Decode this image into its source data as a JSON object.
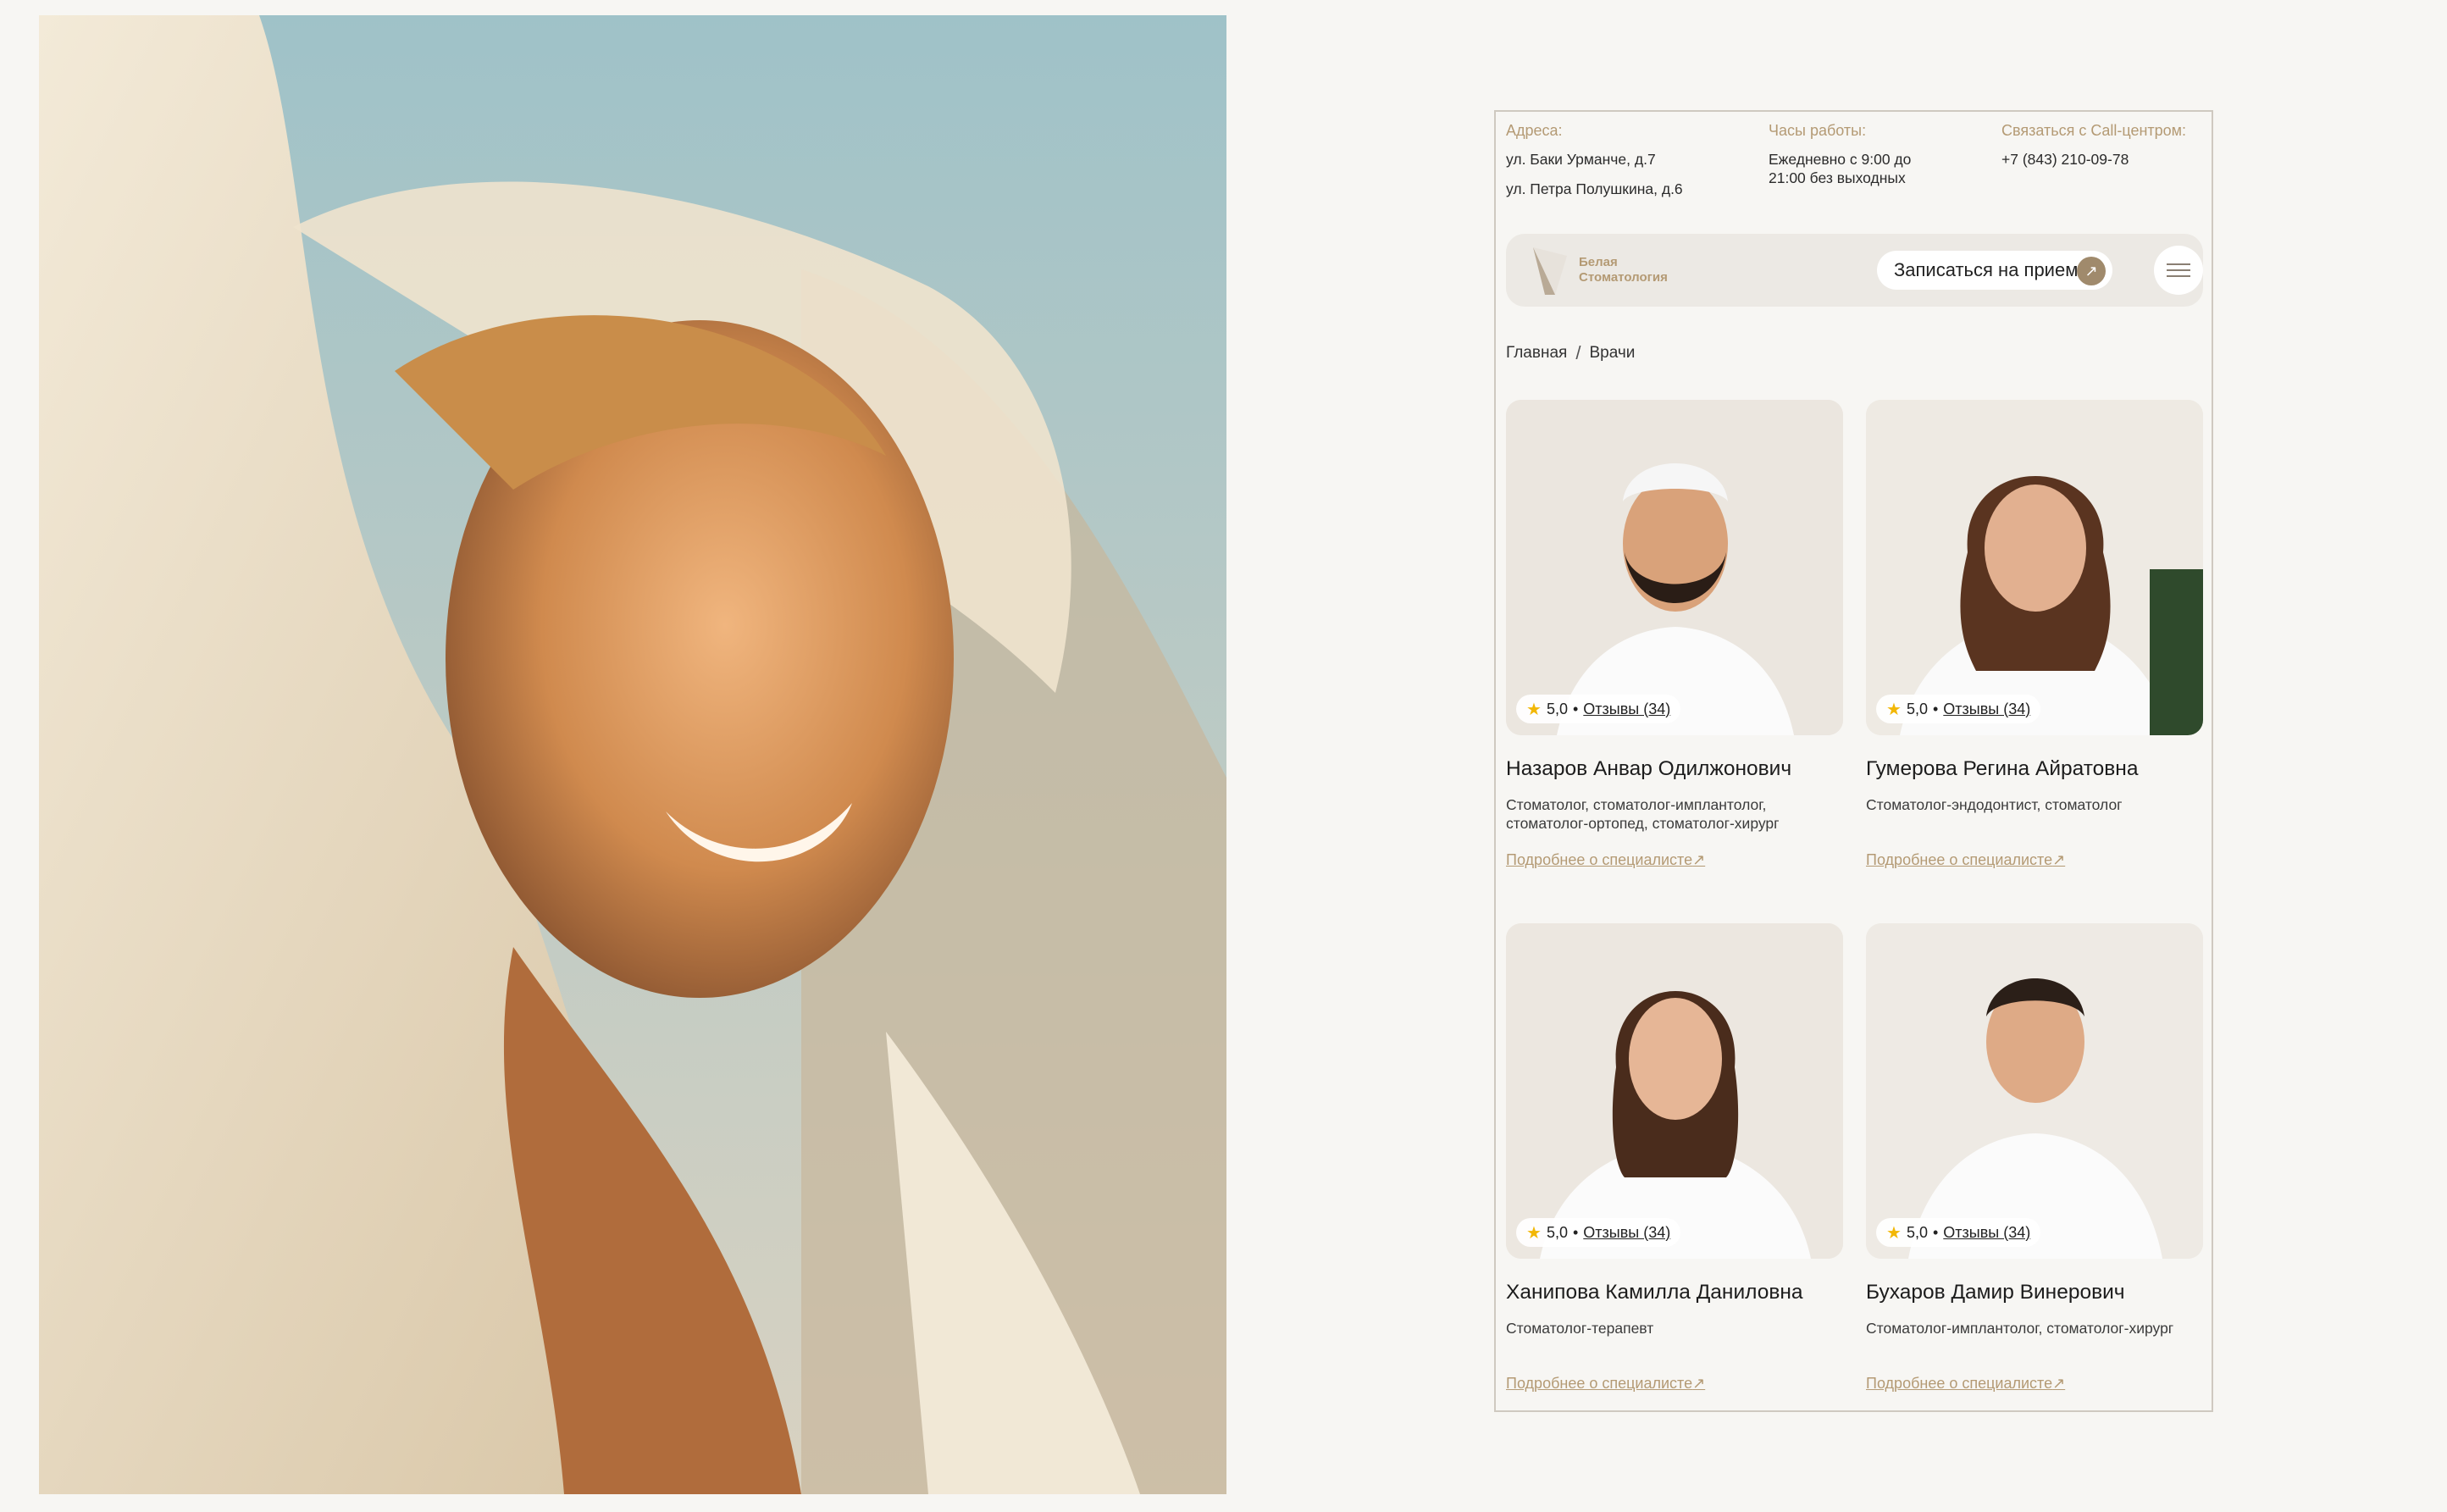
{
  "hero": {
    "icon": "hero-photo-smiling-woman"
  },
  "info": {
    "addresses_label": "Адреса:",
    "address_1": "ул. Баки Урманче, д.7",
    "address_2": "ул. Петра Полушкина, д.6",
    "hours_label": "Часы работы:",
    "hours_line_1": "Ежедневно с 9:00 до",
    "hours_line_2": "21:00 без выходных",
    "call_label": "Связаться с Call-центром:",
    "phone": "+7 (843) 210-09-78"
  },
  "nav": {
    "logo_line_1": "Белая",
    "logo_line_2": "Стоматология",
    "book_label": "Записаться на прием",
    "book_icon": "arrow-up-right-icon",
    "menu_icon": "hamburger-menu-icon"
  },
  "breadcrumb": {
    "home": "Главная",
    "separator": "/",
    "current": "Врачи"
  },
  "doctors": [
    {
      "name": "Назаров Анвар Одилжонович",
      "spec": "Стоматолог, стоматолог-имплантолог, стоматолог-ортопед, стоматолог-хирург",
      "rating": "5,0",
      "reviews": "Отзывы (34)",
      "link": "Подробнее о специалисте"
    },
    {
      "name": "Гумерова Регина Айратовна",
      "spec": "Стоматолог-эндодонтист, стоматолог",
      "rating": "5,0",
      "reviews": "Отзывы (34)",
      "link": "Подробнее о специалисте"
    },
    {
      "name": "Ханипова Камилла Даниловна",
      "spec": "Стоматолог-терапевт",
      "rating": "5,0",
      "reviews": "Отзывы (34)",
      "link": "Подробнее о специалисте"
    },
    {
      "name": "Бухаров Дамир Винерович",
      "spec": "Стоматолог-имплантолог, стоматолог-хирург",
      "rating": "5,0",
      "reviews": "Отзывы (34)",
      "link": "Подробнее о специалисте"
    }
  ],
  "colors": {
    "accent": "#b49a74",
    "background": "#f7f6f3",
    "star": "#f2b705"
  }
}
